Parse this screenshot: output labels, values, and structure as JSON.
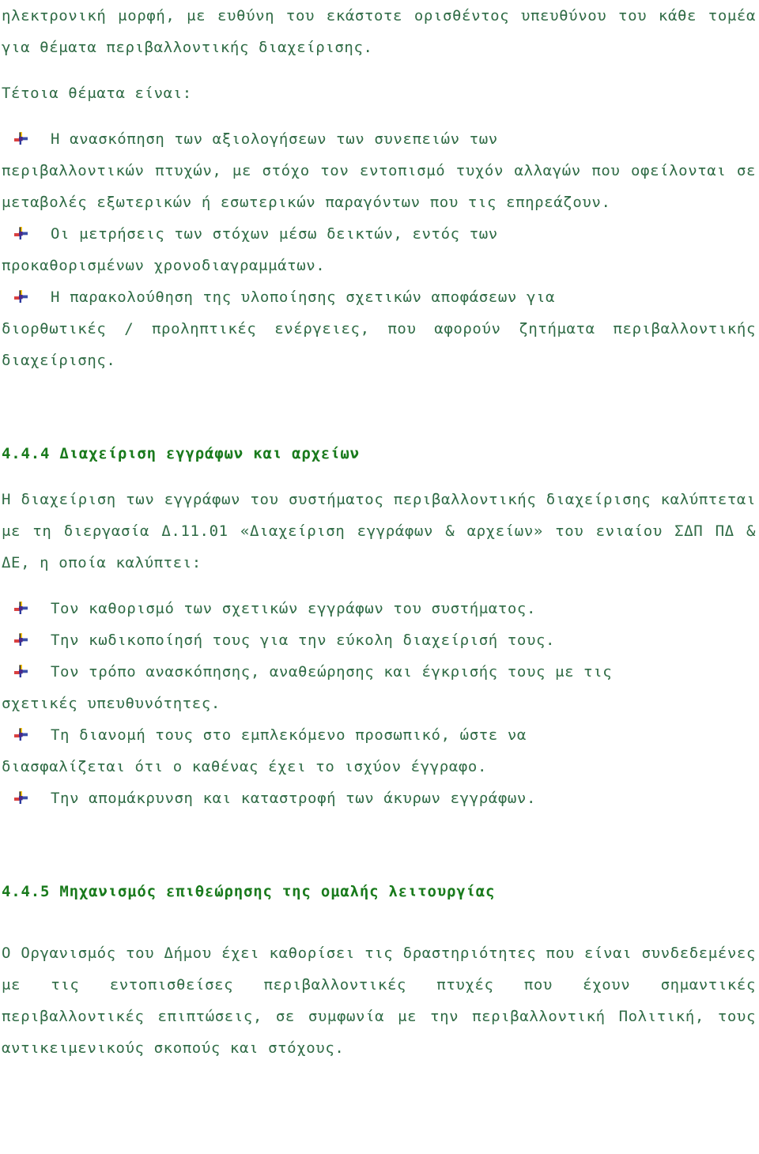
{
  "document": {
    "language": "el",
    "text_color": "#2f6b45",
    "heading_color": "#197a1c",
    "background_color": "#ffffff"
  },
  "bullet_icon": {
    "name": "colored-pinwheel-bullet",
    "colors": {
      "top": "#f2c21a",
      "left": "#d94040",
      "right": "#3b4fa8",
      "center": "#4a2a8a",
      "stem": "#1a1a1a"
    }
  },
  "content": {
    "intro_paragraph": "ηλεκτρονική μορφή, με ευθύνη του εκάστοτε ορισθέντος υπευθύνου του κάθε τομέα για θέματα περιβαλλοντικής διαχείρισης.",
    "such_topics_line": "Τέτοια θέματα είναι:",
    "topics_list": [
      {
        "first": "Η ανασκόπηση των αξιολογήσεων των συνεπειών των",
        "rest": "περιβαλλοντικών πτυχών, με στόχο τον εντοπισμό τυχόν αλλαγών που οφείλονται σε μεταβολές εξωτερικών ή εσωτερικών παραγόντων που τις επηρεάζουν."
      },
      {
        "first": "Οι μετρήσεις των στόχων μέσω δεικτών, εντός των",
        "rest": "προκαθορισμένων χρονοδιαγραμμάτων."
      },
      {
        "first": "Η παρακολούθηση της υλοποίησης σχετικών αποφάσεων για",
        "rest": "διορθωτικές / προληπτικές ενέργειες, που αφορούν ζητήματα περιβαλλοντικής διαχείρισης."
      }
    ],
    "section_444": {
      "heading": "4.4.4 Διαχείριση εγγράφων και αρχείων",
      "paragraph": "Η διαχείριση των εγγράφων του συστήματος περιβαλλοντικής διαχείρισης καλύπτεται με τη διεργασία Δ.11.01 «Διαχείριση εγγράφων & αρχείων» του ενιαίου ΣΔΠ ΠΔ & ΔΕ, η οποία καλύπτει:",
      "list": [
        {
          "first": "Τον καθορισμό των σχετικών εγγράφων του συστήματος.",
          "rest": ""
        },
        {
          "first": "Την κωδικοποίησή τους για την εύκολη διαχείρισή τους.",
          "rest": ""
        },
        {
          "first": "Τον τρόπο ανασκόπησης, αναθεώρησης και έγκρισής τους με τις",
          "rest": "σχετικές υπευθυνότητες."
        },
        {
          "first": "Τη διανομή τους στο εμπλεκόμενο προσωπικό, ώστε να",
          "rest": "διασφαλίζεται ότι ο καθένας έχει το ισχύον έγγραφο."
        },
        {
          "first": "Την απομάκρυνση και καταστροφή των άκυρων εγγράφων.",
          "rest": ""
        }
      ]
    },
    "section_445": {
      "heading": "4.4.5 Μηχανισμός επιθεώρησης της ομαλής λειτουργίας",
      "paragraph": "Ο Οργανισμός του Δήμου έχει καθορίσει τις δραστηριότητες που είναι συνδεδεμένες με τις εντοπισθείσες περιβαλλοντικές πτυχές που έχουν σημαντικές περιβαλλοντικές επιπτώσεις, σε συμφωνία με την περιβαλλοντική Πολιτική, τους αντικειμενικούς σκοπούς και στόχους."
    }
  }
}
